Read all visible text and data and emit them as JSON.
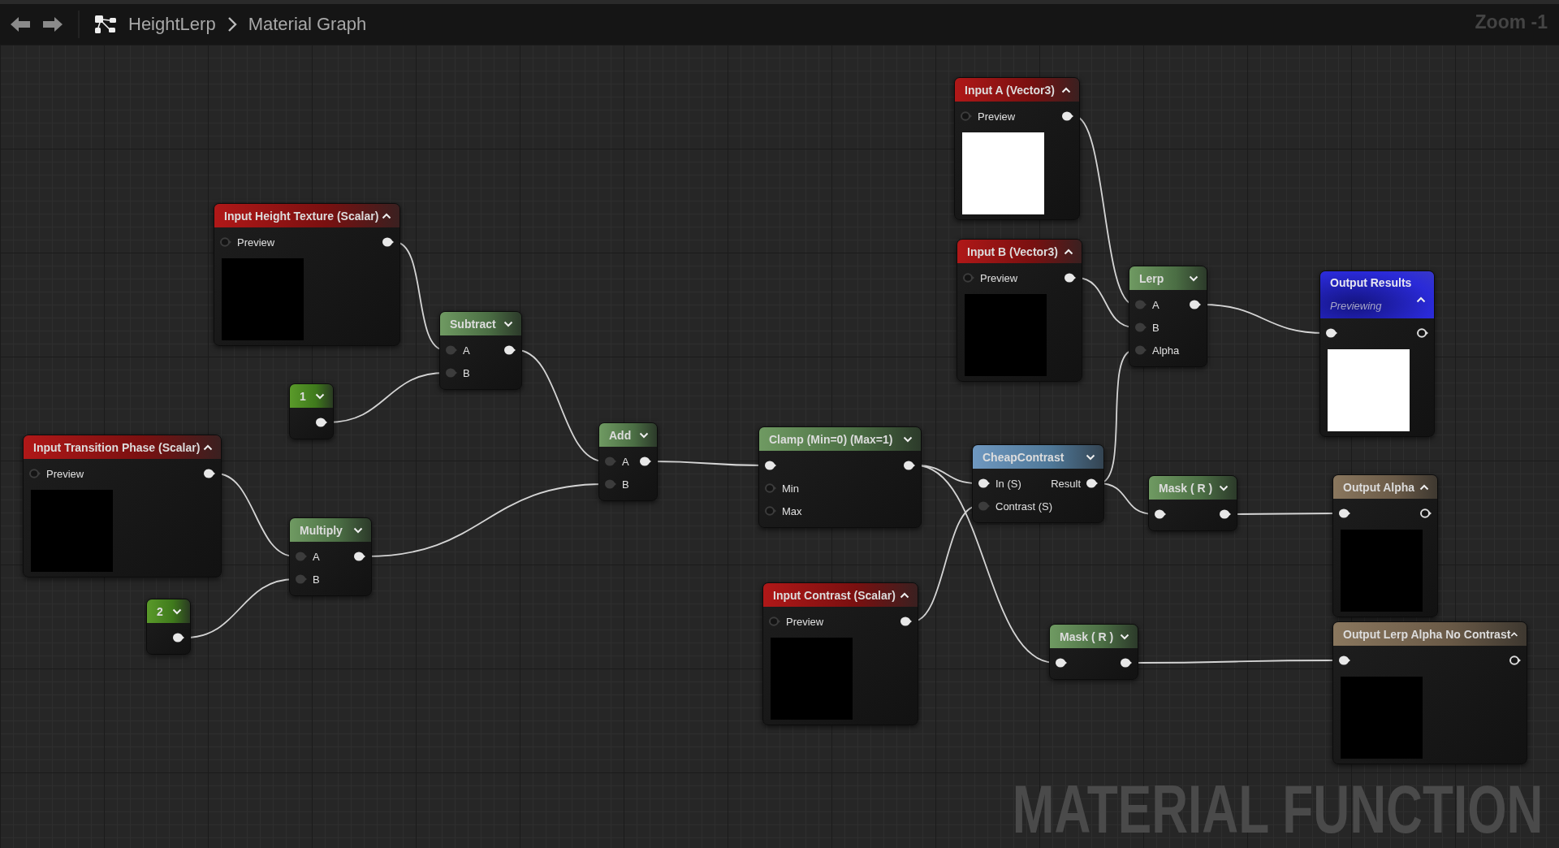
{
  "toolbar": {
    "breadcrumb": [
      "HeightLerp",
      "Material Graph"
    ],
    "zoom": "Zoom -1"
  },
  "graph": {
    "nodes": [
      {
        "kind": "input",
        "title": "Input A (Vector3)",
        "expanded": true,
        "rows": [
          {
            "left": {
              "kind": "hollow"
            },
            "label": "Preview",
            "right": {
              "kind": "filled"
            }
          }
        ],
        "preview": {
          "color": "#ffffff"
        }
      },
      {
        "kind": "input",
        "title": "Input Height Texture (Scalar)",
        "expanded": true,
        "rows": [
          {
            "left": {
              "kind": "hollow"
            },
            "label": "Preview",
            "right": {
              "kind": "filled"
            }
          }
        ],
        "preview": {
          "color": "#000000"
        }
      },
      {
        "kind": "input",
        "title": "Input B (Vector3)",
        "expanded": true,
        "rows": [
          {
            "left": {
              "kind": "hollow"
            },
            "label": "Preview",
            "right": {
              "kind": "filled"
            }
          }
        ],
        "preview": {
          "color": "#000000"
        }
      },
      {
        "kind": "math",
        "title": "Lerp",
        "expanded": false,
        "rows": [
          {
            "left": {
              "kind": "dim"
            },
            "label": "A",
            "right": {
              "kind": "filled"
            }
          },
          {
            "left": {
              "kind": "dim"
            },
            "label": "B"
          },
          {
            "left": {
              "kind": "dim"
            },
            "label": "Alpha"
          }
        ]
      },
      {
        "kind": "result",
        "title": "Output Results",
        "subtitle": "Previewing",
        "expanded": true,
        "rows": [
          {
            "left": {
              "kind": "filled"
            },
            "right": {
              "kind": "ring"
            }
          }
        ],
        "preview": {
          "color": "#ffffff"
        }
      },
      {
        "kind": "math",
        "title": "Subtract",
        "expanded": false,
        "rows": [
          {
            "left": {
              "kind": "dim"
            },
            "label": "A",
            "right": {
              "kind": "filled"
            }
          },
          {
            "left": {
              "kind": "dim"
            },
            "label": "B"
          }
        ]
      },
      {
        "kind": "constant",
        "title": "1",
        "expanded": false,
        "rows": [
          {
            "right": {
              "kind": "filled"
            }
          }
        ]
      },
      {
        "kind": "math",
        "title": "Add",
        "expanded": false,
        "rows": [
          {
            "left": {
              "kind": "dim"
            },
            "label": "A",
            "right": {
              "kind": "filled"
            }
          },
          {
            "left": {
              "kind": "dim"
            },
            "label": "B"
          }
        ]
      },
      {
        "kind": "math",
        "title": "Clamp (Min=0) (Max=1)",
        "expanded": false,
        "rows": [
          {
            "left": {
              "kind": "filled"
            },
            "right": {
              "kind": "filled"
            }
          },
          {
            "left": {
              "kind": "hollow"
            },
            "label": "Min"
          },
          {
            "left": {
              "kind": "hollow"
            },
            "label": "Max"
          }
        ]
      },
      {
        "kind": "input",
        "title": "Input Transition Phase (Scalar)",
        "expanded": true,
        "rows": [
          {
            "left": {
              "kind": "hollow"
            },
            "label": "Preview",
            "right": {
              "kind": "filled"
            }
          }
        ],
        "preview": {
          "color": "#000000"
        }
      },
      {
        "kind": "function",
        "title": "CheapContrast",
        "expanded": false,
        "rows": [
          {
            "left": {
              "kind": "filled"
            },
            "label": "In (S)",
            "right": {
              "kind": "filled"
            },
            "right_label": "Result"
          },
          {
            "left": {
              "kind": "dim"
            },
            "label": "Contrast (S)"
          }
        ]
      },
      {
        "kind": "math",
        "title": "Mask ( R )",
        "expanded": false,
        "rows": [
          {
            "left": {
              "kind": "filled"
            },
            "right": {
              "kind": "filled"
            }
          }
        ]
      },
      {
        "kind": "output",
        "title": "Output Alpha",
        "expanded": true,
        "rows": [
          {
            "left": {
              "kind": "filled"
            },
            "right": {
              "kind": "ring"
            }
          }
        ],
        "preview": {
          "color": "#000000"
        }
      },
      {
        "kind": "math",
        "title": "Multiply",
        "expanded": false,
        "rows": [
          {
            "left": {
              "kind": "dim"
            },
            "label": "A",
            "right": {
              "kind": "filled"
            }
          },
          {
            "left": {
              "kind": "dim"
            },
            "label": "B"
          }
        ]
      },
      {
        "kind": "constant",
        "title": "2",
        "expanded": false,
        "rows": [
          {
            "right": {
              "kind": "filled"
            }
          }
        ]
      },
      {
        "kind": "input",
        "title": "Input Contrast (Scalar)",
        "expanded": true,
        "rows": [
          {
            "left": {
              "kind": "hollow"
            },
            "label": "Preview",
            "right": {
              "kind": "filled"
            }
          }
        ],
        "preview": {
          "color": "#000000"
        }
      },
      {
        "kind": "math",
        "title": "Mask ( R )",
        "expanded": false,
        "rows": [
          {
            "left": {
              "kind": "filled"
            },
            "right": {
              "kind": "filled"
            }
          }
        ]
      },
      {
        "kind": "output",
        "title": "Output Lerp Alpha No Contrast",
        "expanded": true,
        "rows": [
          {
            "left": {
              "kind": "filled"
            },
            "right": {
              "kind": "ring"
            }
          }
        ],
        "preview": {
          "color": "#000000"
        }
      }
    ],
    "graph_label": "MATERIAL FUNCTION"
  }
}
